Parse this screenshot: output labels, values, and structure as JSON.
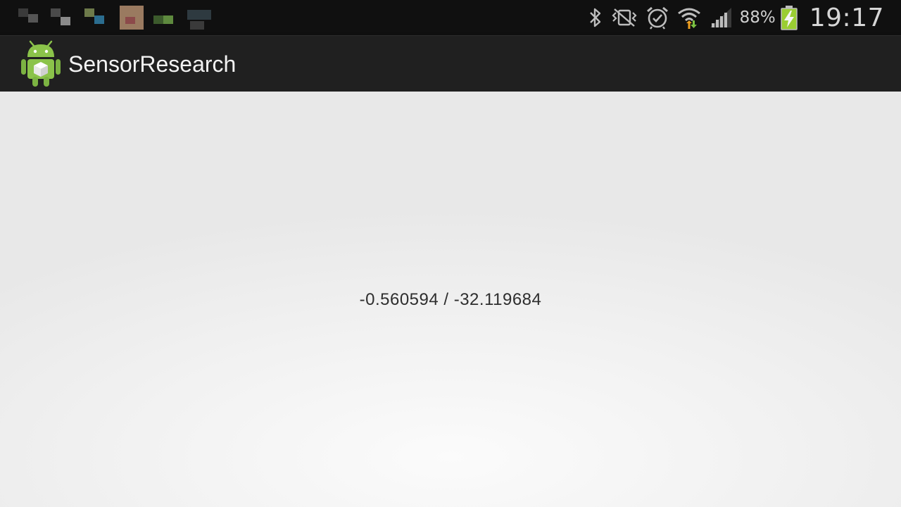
{
  "status_bar": {
    "notification_icons": [
      "pixelated-notification-icons"
    ],
    "icons": [
      "bluetooth-icon",
      "vibrate-icon",
      "alarm-icon",
      "wifi-icon",
      "signal-icon",
      "battery-charging-icon"
    ],
    "battery_percent": "88%",
    "time": "19:17"
  },
  "action_bar": {
    "title": "SensorResearch",
    "icon": "android-robot-icon"
  },
  "main": {
    "sensor_readout": "-0.560594 / -32.119684"
  },
  "colors": {
    "status_bar_bg": "#101010",
    "action_bar_bg": "#202020",
    "content_bg": "#efefef",
    "android_green": "#8bc34a",
    "battery_green": "#9acd32"
  }
}
